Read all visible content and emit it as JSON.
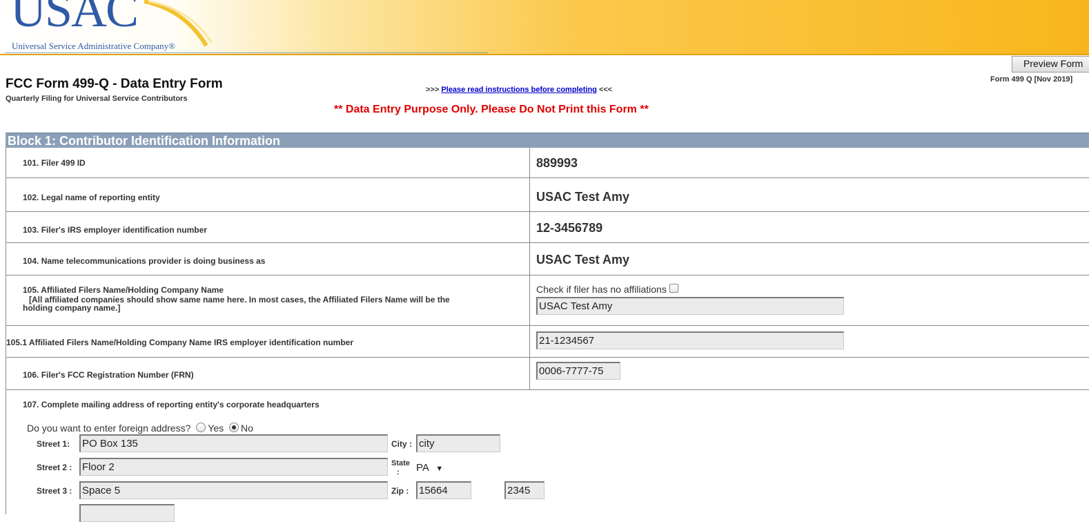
{
  "brand": {
    "logo_text": "USAC",
    "tagline": "Universal Service Administrative Company®"
  },
  "header": {
    "title": "FCC Form 499-Q - Data Entry Form",
    "subtitle": "Quarterly Filing for Universal Service Contributors",
    "instructions_prefix": ">>> ",
    "instructions_link": "Please read instructions before completing",
    "instructions_suffix": " <<<",
    "warning": "** Data Entry Purpose Only. Please Do Not Print this Form **",
    "preview_button": "Preview Form",
    "form_version": "Form 499 Q [Nov 2019]"
  },
  "block1": {
    "title": "Block 1: Contributor Identification Information",
    "line101": {
      "label": "101. Filer 499 ID",
      "value": "889993"
    },
    "line102": {
      "label": "102. Legal name of reporting entity",
      "value": "USAC Test Amy"
    },
    "line103": {
      "label": "103. Filer's IRS employer identification number",
      "value": "12-3456789"
    },
    "line104": {
      "label": "104. Name telecommunications provider is doing business as",
      "value": "USAC Test Amy"
    },
    "line105": {
      "label": "105. Affiliated Filers Name/Holding Company Name",
      "note_line1": "[All affiliated companies should show same name here. In most cases, the Affiliated Filers Name will be the",
      "note_line2": "holding company name.]",
      "checkbox_label": "Check if filer has no affiliations",
      "checked": false,
      "value": "USAC Test Amy"
    },
    "line1051": {
      "label": "105.1 Affiliated Filers Name/Holding Company Name IRS employer identification number",
      "value": "21-1234567"
    },
    "line106": {
      "label": "106. Filer's FCC Registration Number (FRN)",
      "value": "0006-7777-75"
    },
    "line107": {
      "label": "107. Complete mailing address of reporting entity's corporate headquarters",
      "foreign_question": "Do you want to enter foreign address?",
      "foreign_yes": "Yes",
      "foreign_no": "No",
      "foreign_selected": "No",
      "street1_label": "Street 1:",
      "street1": "PO Box 135",
      "street2_label": "Street 2 :",
      "street2": "Floor 2",
      "street3_label": "Street 3 :",
      "street3": "Space 5",
      "city_label": "City :",
      "city": "city",
      "state_label": "State",
      "state_colon": ":",
      "state": "PA",
      "zip_label": "Zip :",
      "zip": "15664",
      "zip_ext": "2345"
    }
  }
}
